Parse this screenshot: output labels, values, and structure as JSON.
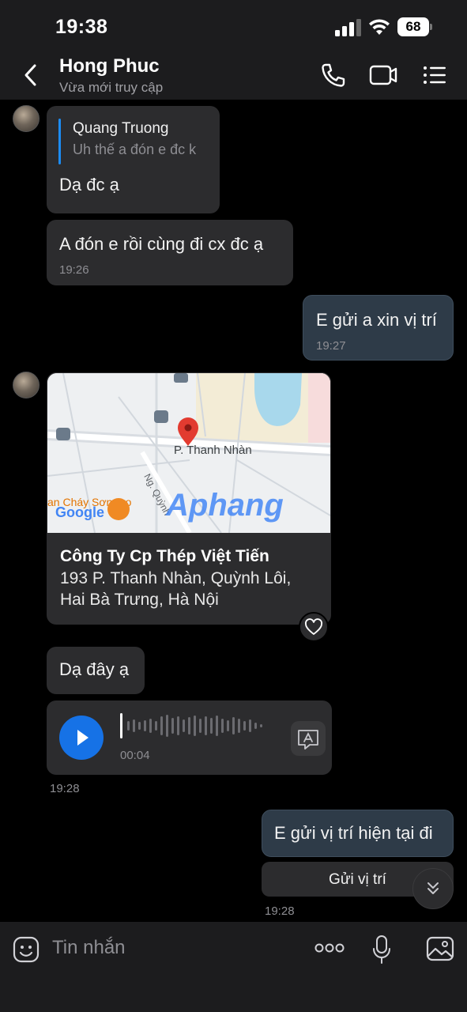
{
  "status_bar": {
    "time": "19:38",
    "battery": "68"
  },
  "header": {
    "title": "Hong Phuc",
    "subtitle": "Vừa mới truy cập",
    "icons": [
      "back-icon",
      "phone-icon",
      "video-call-icon",
      "menu-list-icon"
    ]
  },
  "messages": {
    "m1": {
      "quote_name": "Quang Truong",
      "quote_text": "Uh thế a đón e đc k",
      "text": "Dạ đc ạ"
    },
    "m2": {
      "text": "A đón e rồi cùng đi cx đc ạ",
      "time": "19:26"
    },
    "m3": {
      "text": "E gửi a xin vị trí",
      "time": "19:27"
    },
    "m4": {
      "map_labels": {
        "street": "P. Thanh Nhàn",
        "side_street": "Ng. Quỳnh",
        "poi": "an Cháy Sơn Trọ",
        "brand": "Google",
        "watermark": "Aphang"
      },
      "place_name": "Công Ty Cp Thép Việt Tiến",
      "address_line1": "193 P. Thanh Nhàn, Quỳnh Lôi,",
      "address_line2": "Hai Bà Trưng, Hà Nội"
    },
    "m5": {
      "text": "Dạ đây ạ"
    },
    "m6": {
      "duration": "00:04",
      "time": "19:28"
    },
    "m7": {
      "text": "E gửi vị trí hiện tại đi",
      "button": "Gửi vị trí",
      "time": "19:28"
    }
  },
  "input": {
    "placeholder": "Tin nhắn"
  },
  "colors": {
    "accent_blue": "#1672e6",
    "incoming_bubble": "#2c2c2e",
    "outgoing_bubble": "#2e3b48"
  }
}
